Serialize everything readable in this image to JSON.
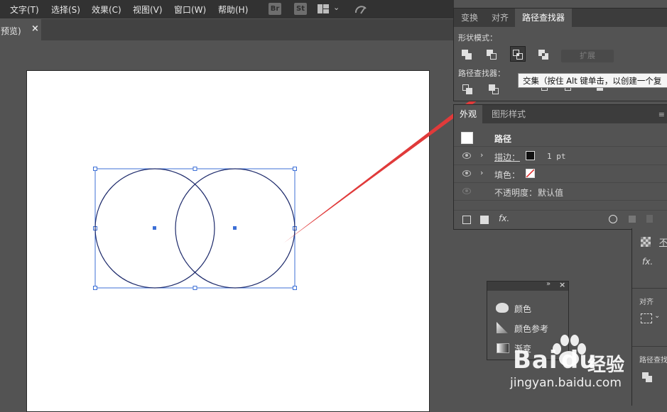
{
  "menu": {
    "items": [
      "文字(T)",
      "选择(S)",
      "效果(C)",
      "视图(V)",
      "窗口(W)",
      "帮助(H)"
    ],
    "bridge_badge": "Br",
    "stock_badge": "St"
  },
  "document": {
    "tab_title": "预览)",
    "close": "×"
  },
  "pathfinder_panel": {
    "tabs": [
      "变换",
      "对齐",
      "路径查找器"
    ],
    "active_tab": "路径查找器",
    "shape_modes_label": "形状模式：",
    "expand_label": "扩展",
    "pathfinders_label": "路径查找器：",
    "tooltip": "交集（按住 Alt 键单击，以创建一个复"
  },
  "appearance_panel": {
    "tabs": [
      "外观",
      "图形样式"
    ],
    "active_tab": "外观",
    "object_type": "路径",
    "stroke_label": "描边：",
    "stroke_value": "1 pt",
    "fill_label": "填色：",
    "opacity_label": "不透明度：",
    "opacity_value": "默认值",
    "fx_label": "fx."
  },
  "color_panel": {
    "items": [
      "颜色",
      "颜色参考",
      "渐变"
    ]
  },
  "right_dock": {
    "partial_label": "不",
    "fx_label": "fx.",
    "align_label": "对齐",
    "pathfinder_label": "路径查找"
  },
  "watermark": {
    "text_baidu": "Bai",
    "text_du": "du",
    "text_jingyan": "经验",
    "url": "jingyan.baidu.com"
  },
  "colors": {
    "selection_blue": "#3c6fd6",
    "circle_stroke": "#1d2a6b",
    "arrow_red": "#e03a3a"
  }
}
